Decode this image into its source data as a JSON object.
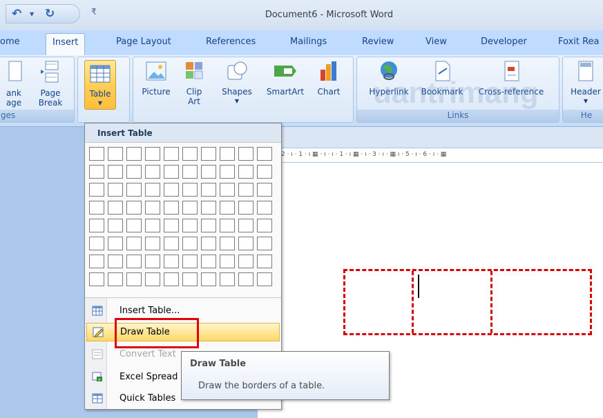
{
  "title": "Document6 - Microsoft Word",
  "tabs": [
    "ome",
    "Insert",
    "Page Layout",
    "References",
    "Mailings",
    "Review",
    "View",
    "Developer",
    "Foxit Rea"
  ],
  "ribbon": {
    "pages": {
      "blank_l1": "ank",
      "blank_l2": "age",
      "break_l1": "Page",
      "break_l2": "Break",
      "label": "ges"
    },
    "table": {
      "label": "Table"
    },
    "illustrations": {
      "picture": "Picture",
      "clip_l1": "Clip",
      "clip_l2": "Art",
      "shapes": "Shapes",
      "smartart": "SmartArt",
      "chart": "Chart"
    },
    "links": {
      "hyperlink": "Hyperlink",
      "bookmark": "Bookmark",
      "crossref": "Cross-reference",
      "label": "Links"
    },
    "header": {
      "label": "Header",
      "group_label": "He"
    }
  },
  "ruler_text": "2 · ı · 1 · ı ▦ · ı · ı · 1 · ı ▦ · ı · 3 · ı · ▦ ı · 5 · ı · 6 · ı · ▦",
  "watermark": "uantrimang",
  "dropdown": {
    "header": "Insert Table",
    "items": [
      {
        "label": "Insert Table...",
        "state": "normal"
      },
      {
        "label": "Draw Table",
        "state": "hover"
      },
      {
        "label": "Convert Text",
        "state": "disabled"
      },
      {
        "label": "Excel Spread",
        "state": "normal"
      },
      {
        "label": "Quick Tables",
        "state": "normal"
      }
    ]
  },
  "tooltip": {
    "title": "Draw Table",
    "body": "Draw the borders of a table."
  },
  "colors": {
    "accent": "#ffcf57",
    "highlight_box": "#e0000a",
    "table_border": "#d40000"
  }
}
